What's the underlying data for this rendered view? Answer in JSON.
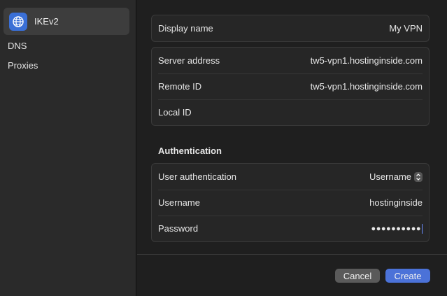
{
  "sidebar": {
    "items": [
      {
        "label": "IKEv2",
        "icon": "globe-icon",
        "selected": true
      },
      {
        "label": "DNS",
        "selected": false
      },
      {
        "label": "Proxies",
        "selected": false
      }
    ]
  },
  "main": {
    "display_group": {
      "rows": [
        {
          "label": "Display name",
          "value": "My VPN"
        }
      ]
    },
    "server_group": {
      "rows": [
        {
          "label": "Server address",
          "value": "tw5-vpn1.hostinginside.com"
        },
        {
          "label": "Remote ID",
          "value": "tw5-vpn1.hostinginside.com"
        },
        {
          "label": "Local ID",
          "value": ""
        }
      ]
    },
    "auth_section_title": "Authentication",
    "auth_group": {
      "rows": [
        {
          "label": "User authentication",
          "value": "Username"
        },
        {
          "label": "Username",
          "value": "hostinginside"
        },
        {
          "label": "Password",
          "value": "●●●●●●●●●●"
        }
      ]
    }
  },
  "footer": {
    "cancel_label": "Cancel",
    "create_label": "Create"
  },
  "colors": {
    "accent": "#4b72d8",
    "sidebar_bg": "#2a2a2a",
    "content_bg": "#1f1f1f"
  }
}
